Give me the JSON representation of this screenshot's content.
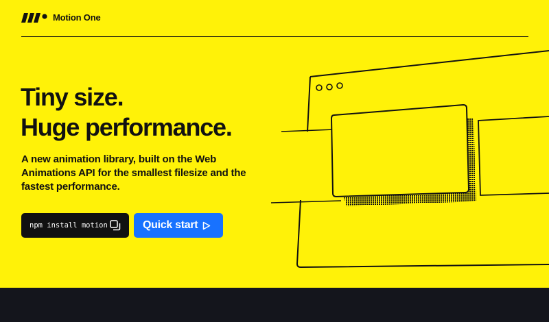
{
  "header": {
    "brand_name": "Motion One",
    "logo_icon": "motion-one-logo-icon"
  },
  "hero": {
    "title_line_1": "Tiny size.",
    "title_line_2": "Huge performance.",
    "subtitle": "A new animation library, built on the Web Animations API for the smallest filesize and the fastest performance."
  },
  "install": {
    "command": "npm install motion",
    "copy_icon": "copy-icon"
  },
  "cta": {
    "quick_start_label": "Quick start",
    "icon": "play-arrow-icon"
  },
  "colors": {
    "background": "#fff208",
    "ink": "#111111",
    "button_blue": "#1872ff",
    "footer_dark": "#14151c"
  }
}
